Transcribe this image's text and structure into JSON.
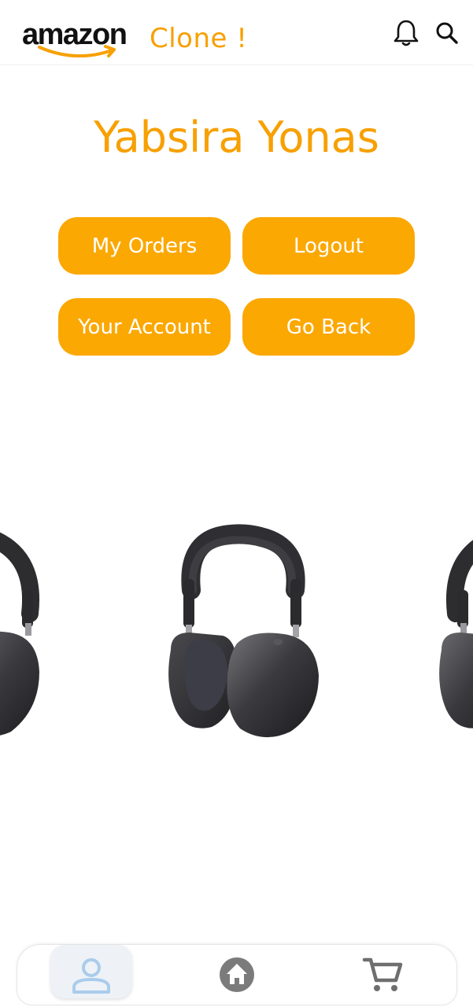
{
  "header": {
    "logo_word": "amazon",
    "logo_suffix": "Clone !",
    "icons": [
      "bell-icon",
      "search-icon"
    ]
  },
  "profile": {
    "name": "Yabsira Yonas"
  },
  "actions": {
    "my_orders": "My Orders",
    "logout": "Logout",
    "your_account": "Your Account",
    "go_back": "Go Back"
  },
  "carousel": {
    "items": [
      "headphones-image",
      "headphones-image",
      "headphones-image"
    ]
  },
  "bottom_nav": {
    "items": [
      {
        "icon": "person-icon",
        "active": true
      },
      {
        "icon": "home-icon",
        "active": false
      },
      {
        "icon": "cart-icon",
        "active": false
      }
    ]
  },
  "colors": {
    "accent": "#fba802",
    "title": "#f7a000",
    "nav_active_icon": "#a9ccec",
    "nav_icon": "#7b7b7b"
  }
}
